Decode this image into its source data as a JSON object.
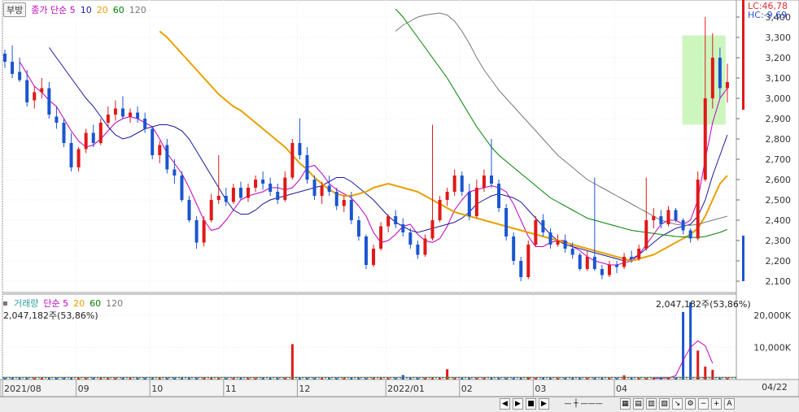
{
  "legend_top": {
    "button": "부방",
    "items": [
      {
        "label": "종가 단순 5",
        "color": "#c000c0"
      },
      {
        "label": "10",
        "color": "#1a1a9a"
      },
      {
        "label": "20",
        "color": "#e8a000"
      },
      {
        "label": "60",
        "color": "#008000"
      },
      {
        "label": "120",
        "color": "#777777"
      }
    ]
  },
  "legend_vol": {
    "items": [
      {
        "label": "거래량",
        "color": "#2aa0a0"
      },
      {
        "label": "단순 5",
        "color": "#c000c0"
      },
      {
        "label": "20",
        "color": "#e8a000"
      },
      {
        "label": "60",
        "color": "#008000"
      },
      {
        "label": "120",
        "color": "#777777"
      }
    ]
  },
  "overlay": {
    "lc": "LC:46,78",
    "hc": "HC:-9,69"
  },
  "volume_readout": "2,047,182주(53,86%)",
  "cursor_date": "04/22",
  "colors": {
    "up": "#e01818",
    "down": "#1a55d0",
    "highlight": "#c8f5b8"
  },
  "controls": [
    "◀",
    "▶",
    "■",
    "▶",
    "−",
    "+",
    "A"
  ],
  "chart_data": [
    {
      "type": "candlestick",
      "title": "",
      "x_ticks": [
        "2021/08",
        "09",
        "10",
        "11",
        "12",
        "2022/01",
        "02",
        "03",
        "04"
      ],
      "y_ticks": [
        "3,400",
        "3,300",
        "3,200",
        "3,100",
        "3,000",
        "2,900",
        "2,800",
        "2,700",
        "2,600",
        "2,500",
        "2,400",
        "2,300",
        "2,200",
        "2,100"
      ],
      "ylim": [
        2070,
        3450
      ],
      "grid": true,
      "ohlc": [
        [
          3220,
          3240,
          3150,
          3180
        ],
        [
          3180,
          3260,
          3100,
          3120
        ],
        [
          3130,
          3200,
          3080,
          3090
        ],
        [
          3090,
          3140,
          2960,
          2980
        ],
        [
          2990,
          3060,
          2950,
          3030
        ],
        [
          3030,
          3100,
          3000,
          3050
        ],
        [
          3050,
          3080,
          2900,
          2920
        ],
        [
          2910,
          2960,
          2850,
          2880
        ],
        [
          2880,
          2900,
          2760,
          2780
        ],
        [
          2780,
          2830,
          2640,
          2660
        ],
        [
          2660,
          2760,
          2640,
          2750
        ],
        [
          2750,
          2850,
          2730,
          2830
        ],
        [
          2830,
          2870,
          2760,
          2780
        ],
        [
          2780,
          2900,
          2770,
          2880
        ],
        [
          2880,
          2960,
          2860,
          2920
        ],
        [
          2920,
          2990,
          2890,
          2950
        ],
        [
          2950,
          3010,
          2900,
          2910
        ],
        [
          2910,
          2950,
          2880,
          2930
        ],
        [
          2930,
          2960,
          2880,
          2900
        ],
        [
          2900,
          2930,
          2830,
          2850
        ],
        [
          2850,
          2860,
          2700,
          2720
        ],
        [
          2720,
          2790,
          2680,
          2770
        ],
        [
          2770,
          2800,
          2630,
          2650
        ],
        [
          2650,
          2700,
          2580,
          2620
        ],
        [
          2620,
          2640,
          2490,
          2500
        ],
        [
          2500,
          2520,
          2390,
          2400
        ],
        [
          2400,
          2420,
          2260,
          2290
        ],
        [
          2290,
          2420,
          2270,
          2400
        ],
        [
          2400,
          2530,
          2390,
          2500
        ],
        [
          2500,
          2720,
          2480,
          2520
        ],
        [
          2520,
          2560,
          2470,
          2490
        ],
        [
          2490,
          2580,
          2480,
          2560
        ],
        [
          2560,
          2590,
          2500,
          2510
        ],
        [
          2510,
          2580,
          2490,
          2560
        ],
        [
          2560,
          2620,
          2540,
          2600
        ],
        [
          2600,
          2640,
          2550,
          2580
        ],
        [
          2580,
          2610,
          2520,
          2540
        ],
        [
          2540,
          2580,
          2480,
          2500
        ],
        [
          2500,
          2640,
          2490,
          2610
        ],
        [
          2610,
          2800,
          2600,
          2780
        ],
        [
          2780,
          2900,
          2700,
          2720
        ],
        [
          2720,
          2760,
          2580,
          2600
        ],
        [
          2600,
          2620,
          2500,
          2520
        ],
        [
          2520,
          2590,
          2480,
          2570
        ],
        [
          2570,
          2620,
          2520,
          2540
        ],
        [
          2540,
          2560,
          2450,
          2470
        ],
        [
          2470,
          2520,
          2440,
          2500
        ],
        [
          2500,
          2540,
          2380,
          2400
        ],
        [
          2400,
          2420,
          2300,
          2320
        ],
        [
          2320,
          2330,
          2160,
          2180
        ],
        [
          2180,
          2280,
          2170,
          2260
        ],
        [
          2260,
          2390,
          2250,
          2370
        ],
        [
          2370,
          2430,
          2340,
          2420
        ],
        [
          2420,
          2450,
          2360,
          2380
        ],
        [
          2380,
          2410,
          2320,
          2340
        ],
        [
          2340,
          2360,
          2260,
          2280
        ],
        [
          2280,
          2300,
          2210,
          2230
        ],
        [
          2230,
          2330,
          2220,
          2310
        ],
        [
          2310,
          2870,
          2300,
          2400
        ],
        [
          2400,
          2520,
          2390,
          2500
        ],
        [
          2500,
          2560,
          2470,
          2540
        ],
        [
          2540,
          2650,
          2520,
          2620
        ],
        [
          2620,
          2640,
          2520,
          2540
        ],
        [
          2540,
          2580,
          2400,
          2420
        ],
        [
          2420,
          2600,
          2410,
          2560
        ],
        [
          2560,
          2650,
          2540,
          2620
        ],
        [
          2620,
          2800,
          2560,
          2580
        ],
        [
          2580,
          2600,
          2440,
          2460
        ],
        [
          2460,
          2480,
          2300,
          2320
        ],
        [
          2320,
          2340,
          2180,
          2200
        ],
        [
          2200,
          2220,
          2100,
          2120
        ],
        [
          2120,
          2300,
          2110,
          2280
        ],
        [
          2280,
          2420,
          2270,
          2400
        ],
        [
          2400,
          2430,
          2320,
          2340
        ],
        [
          2340,
          2360,
          2260,
          2280
        ],
        [
          2280,
          2330,
          2270,
          2300
        ],
        [
          2300,
          2330,
          2240,
          2260
        ],
        [
          2260,
          2290,
          2210,
          2230
        ],
        [
          2230,
          2240,
          2150,
          2160
        ],
        [
          2160,
          2250,
          2150,
          2220
        ],
        [
          2220,
          2610,
          2150,
          2160
        ],
        [
          2160,
          2180,
          2110,
          2130
        ],
        [
          2130,
          2200,
          2120,
          2180
        ],
        [
          2180,
          2200,
          2140,
          2170
        ],
        [
          2170,
          2240,
          2160,
          2220
        ],
        [
          2220,
          2250,
          2190,
          2210
        ],
        [
          2210,
          2280,
          2200,
          2260
        ],
        [
          2260,
          2610,
          2250,
          2400
        ],
        [
          2400,
          2460,
          2360,
          2420
        ],
        [
          2420,
          2450,
          2360,
          2380
        ],
        [
          2380,
          2470,
          2370,
          2450
        ],
        [
          2450,
          2460,
          2390,
          2400
        ],
        [
          2400,
          2410,
          2330,
          2350
        ],
        [
          2350,
          2360,
          2290,
          2310
        ],
        [
          2310,
          2640,
          2300,
          2600
        ],
        [
          2600,
          3400,
          2590,
          3000
        ],
        [
          3000,
          3320,
          2950,
          3200
        ],
        [
          3200,
          3250,
          3000,
          3050
        ],
        [
          3050,
          3170,
          2980,
          3080
        ]
      ],
      "ma_series": [
        {
          "period": 5,
          "color": "#c000c0",
          "values": [
            3180,
            3120,
            3060,
            3030,
            2990,
            2960,
            2900,
            2840,
            2790,
            2760,
            2770,
            2800,
            2840,
            2880,
            2900,
            2910,
            2900,
            2880,
            2860,
            2800,
            2730,
            2680,
            2630,
            2560,
            2480,
            2400,
            2350,
            2360,
            2400,
            2450,
            2500,
            2520,
            2530,
            2540,
            2560,
            2560,
            2550,
            2560,
            2600,
            2660,
            2670,
            2630,
            2580,
            2550,
            2530,
            2510,
            2470,
            2420,
            2340,
            2290,
            2300,
            2330,
            2370,
            2380,
            2330,
            2300,
            2290,
            2310,
            2370,
            2450,
            2500,
            2540,
            2550,
            2560,
            2570,
            2560,
            2540,
            2480,
            2400,
            2320,
            2270,
            2270,
            2290,
            2300,
            2300,
            2270,
            2250,
            2220,
            2200,
            2190,
            2180,
            2180,
            2190,
            2200,
            2230,
            2280,
            2330,
            2380,
            2400,
            2400,
            2380,
            2400,
            2500,
            2700,
            2880,
            3000,
            3050
          ]
        },
        {
          "period": 10,
          "color": "#1a1a9a",
          "values": [
            3250,
            3200,
            3150,
            3100,
            3050,
            3000,
            2960,
            2910,
            2860,
            2820,
            2800,
            2810,
            2830,
            2850,
            2860,
            2870,
            2870,
            2860,
            2840,
            2800,
            2740,
            2680,
            2620,
            2560,
            2500,
            2450,
            2430,
            2430,
            2450,
            2480,
            2500,
            2510,
            2520,
            2530,
            2540,
            2550,
            2560,
            2570,
            2590,
            2610,
            2610,
            2590,
            2560,
            2530,
            2500,
            2460,
            2420,
            2390,
            2370,
            2350,
            2340,
            2350,
            2360,
            2370,
            2380,
            2390,
            2410,
            2440,
            2480,
            2500,
            2520,
            2530,
            2520,
            2510,
            2490,
            2450,
            2410,
            2370,
            2330,
            2300,
            2280,
            2270,
            2260,
            2250,
            2240,
            2230,
            2220,
            2210,
            2200,
            2210,
            2230,
            2260,
            2290,
            2320,
            2340,
            2360,
            2370,
            2380,
            2420,
            2500,
            2620,
            2720,
            2820
          ]
        },
        {
          "period": 20,
          "color": "#e8a000",
          "values": [
            3330,
            3300,
            3260,
            3220,
            3180,
            3140,
            3100,
            3060,
            3020,
            2990,
            2960,
            2940,
            2910,
            2880,
            2850,
            2820,
            2790,
            2760,
            2720,
            2680,
            2650,
            2610,
            2580,
            2550,
            2530,
            2520,
            2520,
            2530,
            2540,
            2560,
            2570,
            2580,
            2570,
            2560,
            2550,
            2540,
            2520,
            2500,
            2480,
            2460,
            2440,
            2430,
            2420,
            2410,
            2400,
            2390,
            2380,
            2370,
            2360,
            2350,
            2340,
            2330,
            2320,
            2310,
            2300,
            2290,
            2280,
            2270,
            2260,
            2250,
            2240,
            2230,
            2220,
            2210,
            2200,
            2210,
            2220,
            2230,
            2250,
            2270,
            2290,
            2310,
            2330,
            2360,
            2420,
            2500,
            2580,
            2620
          ]
        },
        {
          "period": 60,
          "color": "#008000",
          "values": [
            3440,
            3400,
            3350,
            3300,
            3250,
            3200,
            3150,
            3100,
            3040,
            2980,
            2920,
            2860,
            2810,
            2760,
            2720,
            2690,
            2660,
            2630,
            2600,
            2570,
            2540,
            2510,
            2490,
            2470,
            2450,
            2430,
            2410,
            2400,
            2390,
            2380,
            2370,
            2360,
            2350,
            2345,
            2340,
            2335,
            2330,
            2325,
            2320,
            2318,
            2316,
            2315,
            2320,
            2330,
            2340,
            2355
          ]
        },
        {
          "period": 120,
          "color": "#777777",
          "values": [
            3330,
            3360,
            3380,
            3400,
            3410,
            3415,
            3420,
            3410,
            3380,
            3330,
            3270,
            3200,
            3140,
            3090,
            3040,
            3000,
            2960,
            2920,
            2880,
            2840,
            2800,
            2760,
            2720,
            2690,
            2660,
            2630,
            2600,
            2580,
            2560,
            2540,
            2520,
            2500,
            2480,
            2460,
            2440,
            2420,
            2400,
            2390,
            2380,
            2375,
            2375,
            2380,
            2390,
            2400,
            2410,
            2420
          ]
        }
      ]
    },
    {
      "type": "bar",
      "title": "거래량",
      "y_ticks": [
        "20,000K",
        "10,000K"
      ],
      "ylim": [
        0,
        24000
      ],
      "highlight_values": [
        {
          "index": 39,
          "value": 11000
        },
        {
          "index": 54,
          "value": 1400
        },
        {
          "index": 60,
          "value": 3200
        },
        {
          "index": 71,
          "value": 800
        },
        {
          "index": 84,
          "value": 1300
        },
        {
          "index": 92,
          "value": 21000
        },
        {
          "index": 93,
          "value": 24000
        },
        {
          "index": 94,
          "value": 9000
        },
        {
          "index": 95,
          "value": 4000
        },
        {
          "index": 96,
          "value": 3000
        }
      ]
    }
  ]
}
